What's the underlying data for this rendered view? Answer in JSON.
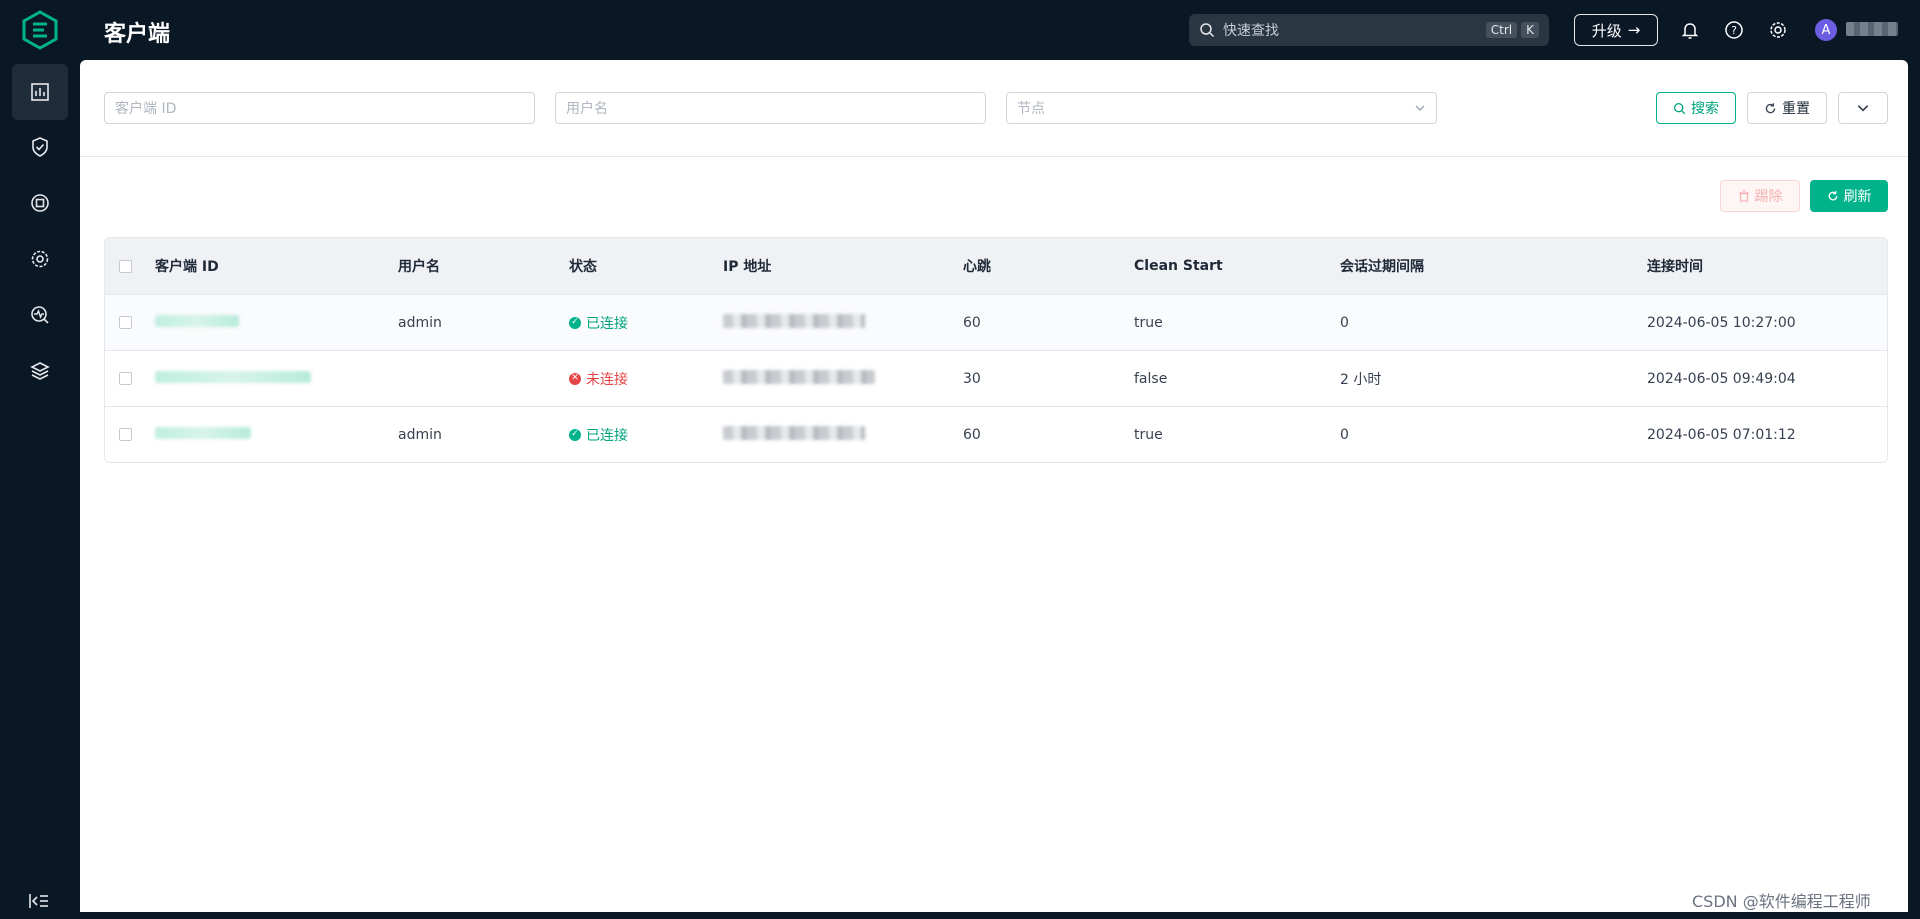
{
  "app": {
    "title": "客户端"
  },
  "topbar": {
    "search_placeholder": "快速查找",
    "shortcut_keys": [
      "Ctrl",
      "K"
    ],
    "upgrade_label": "升级",
    "avatar_letter": "A"
  },
  "sidebar": {
    "items": [
      {
        "icon": "dashboard-icon",
        "active": true
      },
      {
        "icon": "shield-icon",
        "active": false
      },
      {
        "icon": "chip-icon",
        "active": false
      },
      {
        "icon": "gear-chip-icon",
        "active": false
      },
      {
        "icon": "monitor-icon",
        "active": false
      },
      {
        "icon": "layers-icon",
        "active": false
      }
    ],
    "collapse_icon": "collapse-icon"
  },
  "filters": {
    "client_id_placeholder": "客户端 ID",
    "username_placeholder": "用户名",
    "node_placeholder": "节点",
    "search_label": "搜索",
    "reset_label": "重置"
  },
  "toolbar": {
    "delete_label": "踢除",
    "refresh_label": "刷新"
  },
  "table": {
    "columns": [
      "客户端 ID",
      "用户名",
      "状态",
      "IP 地址",
      "心跳",
      "Clean Start",
      "会话过期间隔",
      "连接时间"
    ],
    "rows": [
      {
        "username": "admin",
        "status": "已连接",
        "connected": true,
        "heartbeat": "60",
        "clean_start": "true",
        "expiry": "0",
        "time": "2024-06-05 10:27:00"
      },
      {
        "username": "",
        "status": "未连接",
        "connected": false,
        "heartbeat": "30",
        "clean_start": "false",
        "expiry": "2 小时",
        "time": "2024-06-05 09:49:04"
      },
      {
        "username": "admin",
        "status": "已连接",
        "connected": true,
        "heartbeat": "60",
        "clean_start": "true",
        "expiry": "0",
        "time": "2024-06-05 07:01:12"
      }
    ]
  },
  "watermark": "CSDN @软件编程工程师",
  "colors": {
    "brand": "#00b38a",
    "error": "#e54545",
    "sidebar_bg": "#0a1826"
  }
}
